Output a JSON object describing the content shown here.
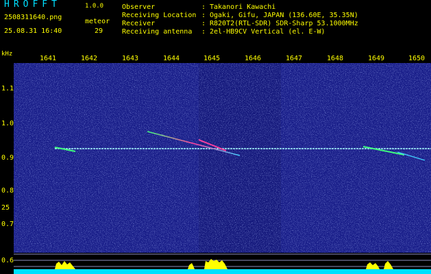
{
  "header": {
    "app_title": "HROFFT",
    "app_version": "1.0.0",
    "file_name": "2508311640.png",
    "datetime": "25.08.31 16:40",
    "meteor_label": "meteor",
    "meteor_count": "29"
  },
  "info": [
    {
      "key": "Observer",
      "value": "Takanori Kawachi"
    },
    {
      "key": "Receiving Location",
      "value": "Ogaki, Gifu, JAPAN (136.60E, 35.35N)"
    },
    {
      "key": "Receiver",
      "value": "R820T2(RTL-SDR) SDR-Sharp 53.1000MHz"
    },
    {
      "key": "Receiving antenna",
      "value": "2el-HB9CV Vertical (el. E-W)"
    }
  ],
  "axis": {
    "unit": "kHz",
    "time_labels": [
      "1641",
      "1642",
      "1643",
      "1644",
      "1645",
      "1646",
      "1647",
      "1648",
      "1649",
      "1650"
    ],
    "freq_labels": [
      "1.1",
      "1.0",
      "0.9",
      "0.8",
      "0.7",
      "0.6"
    ],
    "secondary_freq_labels": [
      "0.6"
    ],
    "extra_freq_label": "25"
  },
  "colors": {
    "header_text": "#ffff00",
    "title_text": "#00e0ff",
    "background": "#000000",
    "spectrogram_bg": "#1a1f8a",
    "carrier_line": "#a8ffff",
    "meteor_trail": "#40ff80",
    "meteor_core": "#ff40a0",
    "bottom_bar": "#00e0ff",
    "peak_bars": "#ffff00",
    "grid_line": "#c0c0ff"
  }
}
